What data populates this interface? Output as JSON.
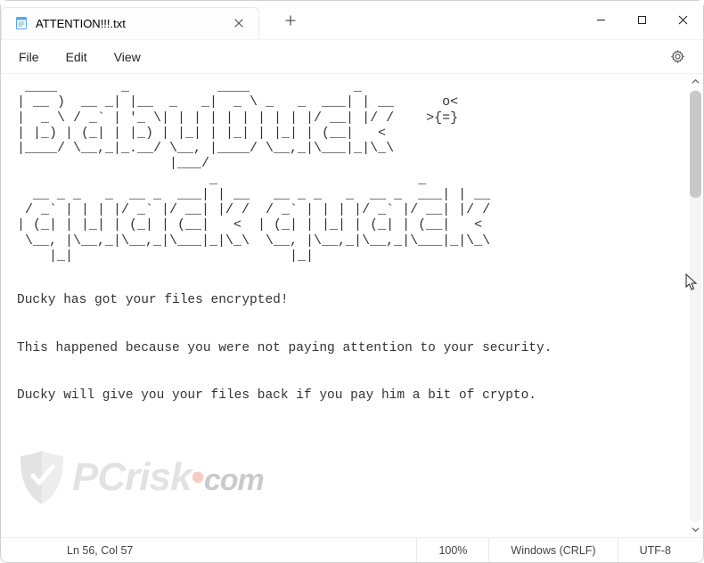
{
  "window": {
    "tab_title": "ATTENTION!!!.txt"
  },
  "menu": {
    "file": "File",
    "edit": "Edit",
    "view": "View"
  },
  "content": {
    "ascii_art": " ____        _           ____             _    \n| __ )  __ _| |__  _   _|  _ \\ _   _  ___| | __      o<\n|  _ \\ / _` | '_ \\| | | | | | | | | |/ __| |/ /    >{=}\n| |_) | (_| | |_) | |_| | |_| | |_| | (__|   < \n|____/ \\__,_|_.__/ \\__, |____/ \\__,_|\\___|_|\\_\\\n                   |___/                       \n                        _                         _    \n  __ _ _   _  __ _  ___| | __   __ _ _   _  __ _  ___| | __\n / _` | | | |/ _` |/ __| |/ /  / _` | | | |/ _` |/ __| |/ /\n| (_| | |_| | (_| | (__|   <  | (_| | |_| | (_| | (__|   < \n \\__, |\\__,_|\\__,_|\\___|_|\\_\\  \\__, |\\__,_|\\__,_|\\___|_|\\_\\\n    |_|                           |_|                      ",
    "line1": "Ducky has got your files encrypted!",
    "line2": "This happened because you were not paying attention to your security.",
    "line3": "Ducky will give you your files back if you pay him a bit of crypto."
  },
  "status": {
    "position": "Ln 56, Col 57",
    "zoom": "100%",
    "line_ending": "Windows (CRLF)",
    "encoding": "UTF-8"
  },
  "watermark": {
    "brand_prefix": "PC",
    "brand_suffix": "risk",
    "dot": "•",
    "tld": "com"
  }
}
